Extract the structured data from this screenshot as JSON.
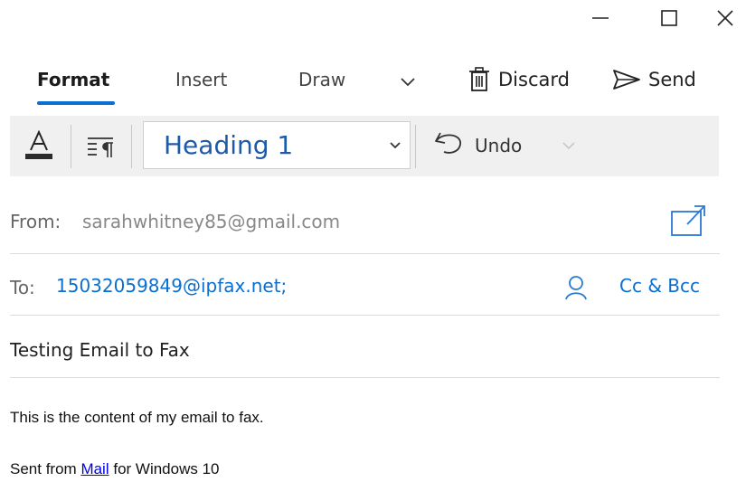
{
  "tabs": [
    {
      "label": "Format",
      "active": true
    },
    {
      "label": "Insert",
      "active": false
    },
    {
      "label": "Draw",
      "active": false
    }
  ],
  "commands": {
    "discard_label": "Discard",
    "send_label": "Send"
  },
  "toolbar": {
    "style_value": "Heading 1",
    "undo_label": "Undo"
  },
  "message": {
    "from_label": "From:",
    "from_value": "sarahwhitney85@gmail.com",
    "to_label": "To:",
    "to_value": "15032059849@ipfax.net;",
    "cc_bcc_label": "Cc & Bcc",
    "subject": "Testing Email to Fax",
    "body_line1": "This is the content of my email to fax.",
    "signature_prefix": "Sent from",
    "signature_link": "Mail",
    "signature_suffix": "for Windows 10"
  },
  "colors": {
    "accent": "#0a6fd1",
    "link": "#0a6fd1",
    "style_text": "#1e5aa8",
    "toolbar_bg": "#f0f0f0"
  },
  "icons": {
    "minimize": "minimize-icon",
    "maximize": "maximize-icon",
    "close": "close-icon",
    "more": "chevron-down-icon",
    "discard": "trash-icon",
    "send": "send-icon",
    "font_color": "font-color-icon",
    "paragraph": "paragraph-format-icon",
    "undo": "undo-icon",
    "popout": "popout-icon",
    "contacts": "person-icon"
  }
}
